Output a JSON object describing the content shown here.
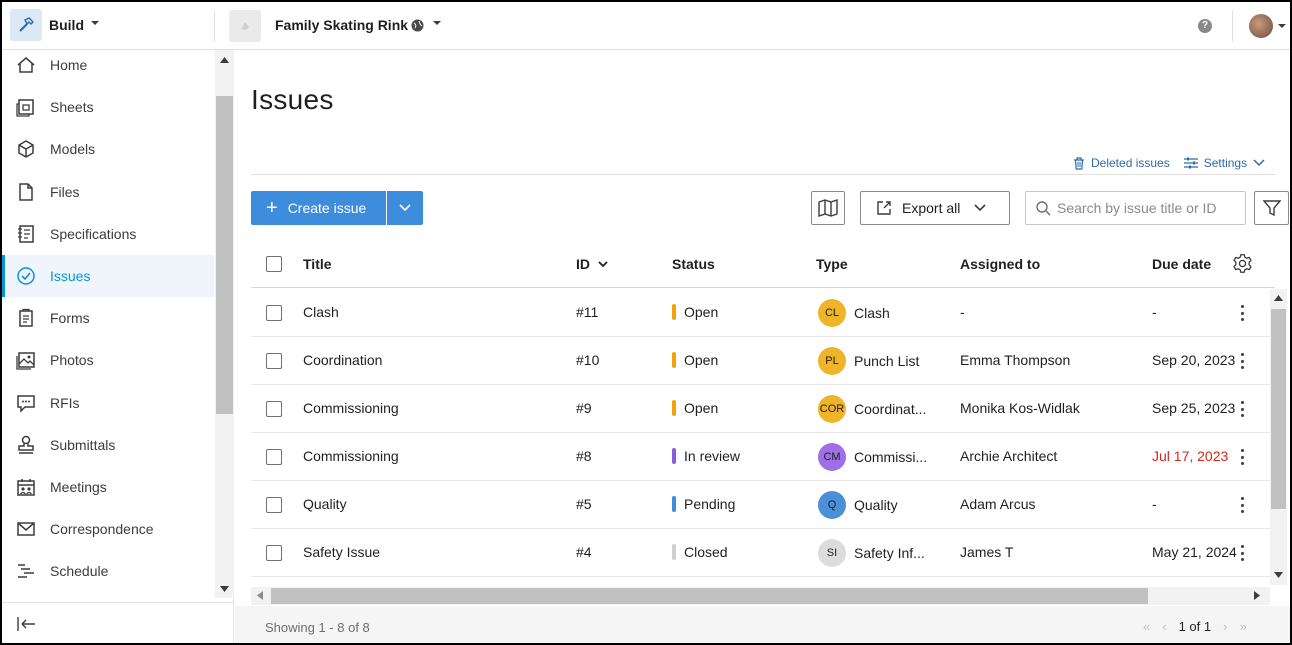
{
  "app": {
    "name": "Build"
  },
  "project": {
    "name": "Family Skating Rink"
  },
  "sidebar": {
    "items": [
      {
        "label": "Home",
        "icon": "home-icon"
      },
      {
        "label": "Sheets",
        "icon": "sheets-icon"
      },
      {
        "label": "Models",
        "icon": "cube-icon"
      },
      {
        "label": "Files",
        "icon": "file-icon"
      },
      {
        "label": "Specifications",
        "icon": "specifications-icon"
      },
      {
        "label": "Issues",
        "icon": "check-circle-icon",
        "active": true
      },
      {
        "label": "Forms",
        "icon": "clipboard-icon"
      },
      {
        "label": "Photos",
        "icon": "photo-icon"
      },
      {
        "label": "RFIs",
        "icon": "chat-icon"
      },
      {
        "label": "Submittals",
        "icon": "stamp-icon"
      },
      {
        "label": "Meetings",
        "icon": "calendar-people-icon"
      },
      {
        "label": "Correspondence",
        "icon": "envelope-icon"
      },
      {
        "label": "Schedule",
        "icon": "schedule-icon"
      }
    ]
  },
  "page": {
    "title": "Issues"
  },
  "toolbar": {
    "deleted_issues": "Deleted issues",
    "settings": "Settings",
    "create_issue": "Create issue",
    "export_all": "Export all",
    "search_placeholder": "Search by issue title or ID"
  },
  "table": {
    "columns": {
      "title": "Title",
      "id": "ID",
      "status": "Status",
      "type": "Type",
      "assigned": "Assigned to",
      "due": "Due date"
    },
    "rows": [
      {
        "title": "Clash",
        "id": "#11",
        "status": "Open",
        "status_color": "#f0a30a",
        "badge": "CL",
        "badge_color": "#f0b429",
        "type": "Clash",
        "assigned": "-",
        "due": "-",
        "overdue": false
      },
      {
        "title": "Coordination",
        "id": "#10",
        "status": "Open",
        "status_color": "#f0a30a",
        "badge": "PL",
        "badge_color": "#f0b429",
        "type": "Punch List",
        "assigned": "Emma Thompson",
        "due": "Sep 20, 2023",
        "overdue": false
      },
      {
        "title": "Commissioning",
        "id": "#9",
        "status": "Open",
        "status_color": "#f0a30a",
        "badge": "COR",
        "badge_color": "#f0b429",
        "type": "Coordinat...",
        "assigned": "Monika Kos-Widlak",
        "due": "Sep 25, 2023",
        "overdue": false
      },
      {
        "title": "Commissioning",
        "id": "#8",
        "status": "In review",
        "status_color": "#8a5cd8",
        "badge": "CM",
        "badge_color": "#a06ee6",
        "type": "Commissi...",
        "assigned": "Archie Architect",
        "due": "Jul 17, 2023",
        "overdue": true
      },
      {
        "title": "Quality",
        "id": "#5",
        "status": "Pending",
        "status_color": "#3e8ddd",
        "badge": "Q",
        "badge_color": "#4a90d9",
        "type": "Quality",
        "assigned": "Adam Arcus",
        "due": "-",
        "overdue": false
      },
      {
        "title": "Safety Issue",
        "id": "#4",
        "status": "Closed",
        "status_color": "#d0d0d0",
        "badge": "SI",
        "badge_color": "#dcdcdc",
        "type": "Safety Inf...",
        "assigned": "James T",
        "due": "May 21, 2024",
        "overdue": false
      }
    ]
  },
  "footer": {
    "showing": "Showing 1 - 8 of 8",
    "page": "1 of 1"
  },
  "colors": {
    "accent": "#0696d7",
    "button": "#3e8ddd",
    "overdue": "#d1291f"
  }
}
